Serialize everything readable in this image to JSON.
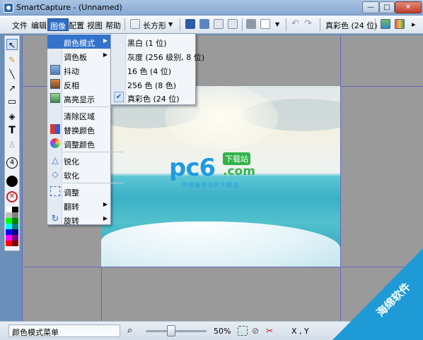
{
  "window": {
    "title": "SmartCapture - (Unnamed)",
    "min": "—",
    "max": "□",
    "close": "✕"
  },
  "menubar": {
    "items": [
      "文件",
      "编辑",
      "图像",
      "配置",
      "视图",
      "帮助"
    ],
    "active": "图像"
  },
  "toolbar": {
    "shape": "长方形",
    "color_mode": "真彩色 (24 位)",
    "dd_arrow": "▼"
  },
  "image_menu": {
    "items": [
      {
        "label": "颜色模式",
        "submenu": true
      },
      {
        "label": "调色板",
        "submenu": true
      },
      {
        "label": "抖动"
      },
      {
        "label": "反相"
      },
      {
        "label": "高亮显示"
      },
      {
        "label": "清除区域"
      },
      {
        "label": "替换颜色"
      },
      {
        "label": "调整颜色"
      },
      {
        "label": "锐化"
      },
      {
        "label": "软化"
      },
      {
        "label": "调整"
      },
      {
        "label": "翻转",
        "submenu": true
      },
      {
        "label": "旋转",
        "submenu": true
      }
    ]
  },
  "color_mode_menu": {
    "items": [
      "黑白 (1 位)",
      "灰度 (256 级别, 8 位)",
      "16 色 (4 位)",
      "256 色 (8 色)",
      "真彩色 (24 位)"
    ],
    "checked": "真彩色 (24 位)"
  },
  "canvas_logo": {
    "main": "pc6",
    "badge": "下载站",
    "com": ".com",
    "sub": "中国最安全的下载站"
  },
  "tools": {
    "text_tool": "T",
    "number_tool": "4"
  },
  "statusbar": {
    "message": "颜色模式菜单",
    "zoom": "50%",
    "coords": "X , Y"
  },
  "watermark": {
    "text": "海绵软件"
  },
  "colors": {
    "accent": "#3373cc",
    "canvas": "#9a9a9a",
    "guide": "#2f3ad8"
  }
}
